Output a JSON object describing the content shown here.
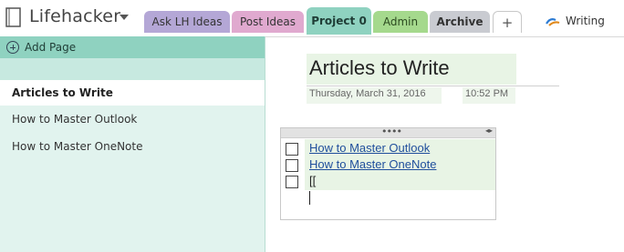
{
  "notebook": {
    "name": "Lifehacker",
    "icon": "notebook-icon"
  },
  "tabs": [
    {
      "label": "Ask LH Ideas",
      "color": "#b4a7d6"
    },
    {
      "label": "Post Ideas",
      "color": "#e0a9cf"
    },
    {
      "label": "Project 0",
      "color": "#8fd2c0",
      "selected": true
    },
    {
      "label": "Admin",
      "color": "#a5d98d"
    },
    {
      "label": "Archive",
      "color": "#c9cbd1"
    },
    {
      "label": "+",
      "color": "#ffffff"
    }
  ],
  "sync": {
    "label": "Writing",
    "icon": "sync-icon"
  },
  "sidebar": {
    "add_page_label": "Add Page",
    "pages": [
      {
        "label": "Articles to Write",
        "selected": true
      },
      {
        "label": "How to Master Outlook"
      },
      {
        "label": "How to Master OneNote"
      }
    ]
  },
  "page": {
    "title": "Articles to Write",
    "date": "Thursday, March 31, 2016",
    "time": "10:52 PM",
    "grip": "••••",
    "arrows": "◂▸",
    "items": [
      {
        "text": "How to Master Outlook",
        "type": "link",
        "checked": false
      },
      {
        "text": "How to Master OneNote",
        "type": "link",
        "checked": false
      },
      {
        "text": "[[",
        "type": "text",
        "checked": false
      }
    ]
  },
  "colors": {
    "accent": "#8fd2c0",
    "panel": "#e1f3ee",
    "link": "#1f4e9c"
  }
}
